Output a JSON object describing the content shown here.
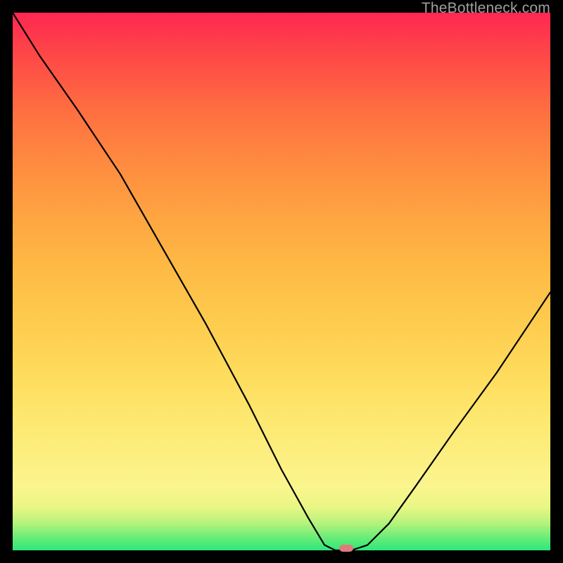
{
  "watermark": {
    "text": "TheBottleneck.com"
  },
  "chart_data": {
    "type": "line",
    "title": "",
    "xlabel": "",
    "ylabel": "",
    "xlim": [
      0,
      100
    ],
    "ylim": [
      0,
      100
    ],
    "grid": false,
    "legend": false,
    "series": [
      {
        "name": "bottleneck-curve",
        "x": [
          0,
          5,
          12,
          20,
          28,
          36,
          44,
          50,
          55,
          58,
          60,
          63,
          66,
          70,
          75,
          82,
          90,
          100
        ],
        "values": [
          100,
          92,
          82,
          70,
          56,
          42,
          27,
          15,
          6,
          1,
          0,
          0,
          1,
          5,
          12,
          22,
          33,
          48
        ]
      }
    ],
    "marker": {
      "x": 62,
      "y": 0,
      "color": "#e17a7c"
    },
    "gradient_stops": [
      {
        "pos": 0,
        "color": "#2fe77a"
      },
      {
        "pos": 8,
        "color": "#e9f684"
      },
      {
        "pos": 25,
        "color": "#fde76e"
      },
      {
        "pos": 52,
        "color": "#febb45"
      },
      {
        "pos": 82,
        "color": "#fe6e41"
      },
      {
        "pos": 100,
        "color": "#fe2751"
      }
    ]
  }
}
